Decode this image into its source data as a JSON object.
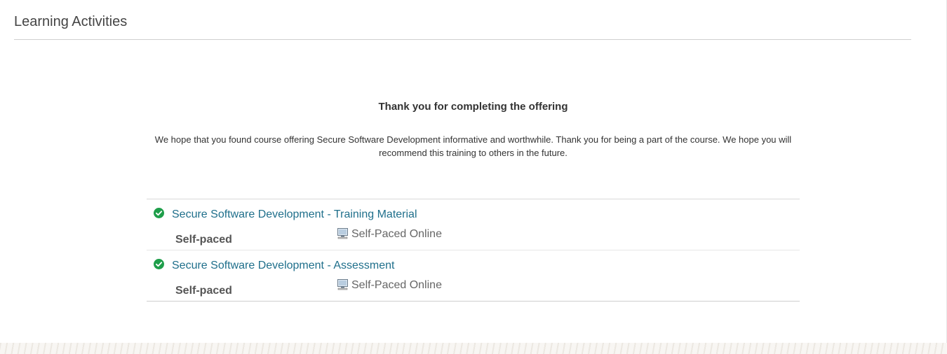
{
  "section": {
    "title": "Learning Activities"
  },
  "completion": {
    "heading": "Thank you for completing the offering",
    "message": "We hope that you found course offering Secure Software Development informative and worthwhile. Thank you for being a part of the course. We hope you will recommend this training to others in the future."
  },
  "activities": [
    {
      "title": "Secure Software Development - Training Material",
      "pace": "Self-paced",
      "delivery": "Self-Paced Online",
      "status_icon": "check-circle-icon",
      "delivery_icon": "computer-icon"
    },
    {
      "title": "Secure Software Development - Assessment",
      "pace": "Self-paced",
      "delivery": "Self-Paced Online",
      "status_icon": "check-circle-icon",
      "delivery_icon": "computer-icon"
    }
  ],
  "colors": {
    "link": "#1f6f8b",
    "complete": "#1e9e4a",
    "divider": "#cfcfcf"
  }
}
